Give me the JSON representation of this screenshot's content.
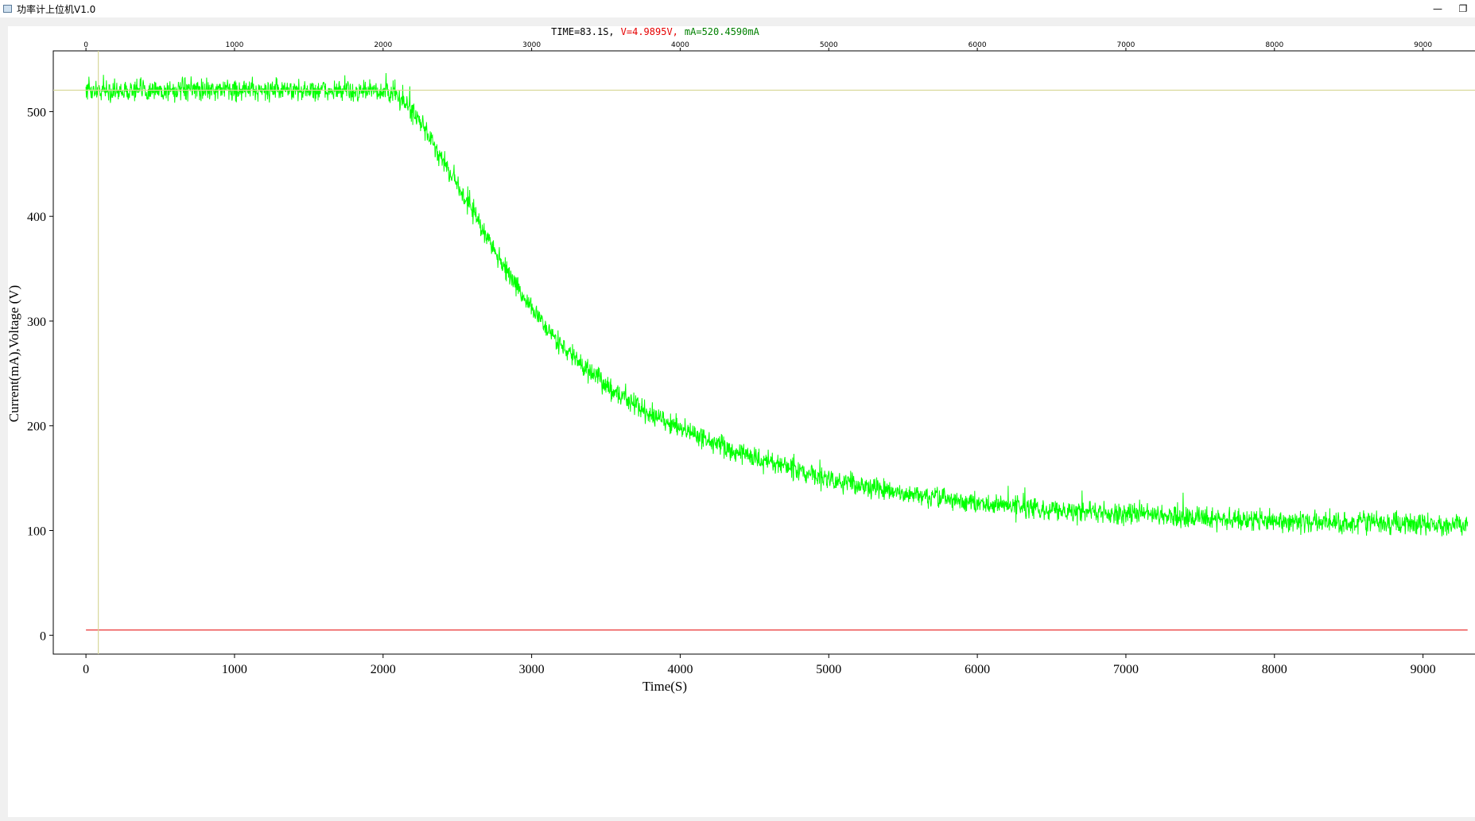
{
  "window": {
    "title": "功率计上位机V1.0",
    "minimize_glyph": "—",
    "restore_glyph": "❐"
  },
  "chart_data": {
    "type": "line",
    "readout": {
      "time": "TIME=83.1S,",
      "voltage": "V=4.9895V,",
      "current": "mA=520.4590mA"
    },
    "xlabel": "Time(S)",
    "ylabel": "Current(mA),Voltage (V)",
    "xlim": [
      -220,
      9350
    ],
    "ylim": [
      -18,
      558
    ],
    "x_ticks": [
      0,
      1000,
      2000,
      3000,
      4000,
      5000,
      6000,
      7000,
      8000,
      9000
    ],
    "x_tick_labels": [
      "0",
      "1000",
      "2000",
      "3000",
      "4000",
      "5000",
      "6000",
      "7000",
      "8000",
      "9000"
    ],
    "y_ticks": [
      0,
      100,
      200,
      300,
      400,
      500
    ],
    "y_tick_labels": [
      "0",
      "100",
      "200",
      "300",
      "400",
      "500"
    ],
    "cursor": {
      "x": 83.1,
      "y": 520.459
    },
    "series": [
      {
        "role": "current",
        "color": "#00ff00",
        "noise_mA": 7,
        "points": [
          [
            0,
            520
          ],
          [
            500,
            520
          ],
          [
            1000,
            521
          ],
          [
            1500,
            520
          ],
          [
            2000,
            519
          ],
          [
            2100,
            515
          ],
          [
            2200,
            500
          ],
          [
            2300,
            478
          ],
          [
            2400,
            455
          ],
          [
            2500,
            430
          ],
          [
            2600,
            405
          ],
          [
            2700,
            380
          ],
          [
            2800,
            355
          ],
          [
            2900,
            333
          ],
          [
            3000,
            313
          ],
          [
            3100,
            293
          ],
          [
            3200,
            277
          ],
          [
            3300,
            263
          ],
          [
            3400,
            250
          ],
          [
            3500,
            239
          ],
          [
            3600,
            229
          ],
          [
            3700,
            220
          ],
          [
            3800,
            211
          ],
          [
            3900,
            204
          ],
          [
            4000,
            197
          ],
          [
            4200,
            185
          ],
          [
            4400,
            175
          ],
          [
            4600,
            165
          ],
          [
            4800,
            156
          ],
          [
            5000,
            149
          ],
          [
            5500,
            135
          ],
          [
            6000,
            126
          ],
          [
            6500,
            120
          ],
          [
            7000,
            116
          ],
          [
            7500,
            112
          ],
          [
            8000,
            109
          ],
          [
            8500,
            107
          ],
          [
            9000,
            106
          ],
          [
            9300,
            105
          ]
        ]
      },
      {
        "role": "voltage",
        "color": "#e60000",
        "points": [
          [
            0,
            5
          ],
          [
            9300,
            5
          ]
        ]
      }
    ],
    "colors": {
      "current": "#00ff00",
      "voltage": "#ff0000",
      "cursor": "#d8d89a",
      "axis": "#000000"
    }
  }
}
